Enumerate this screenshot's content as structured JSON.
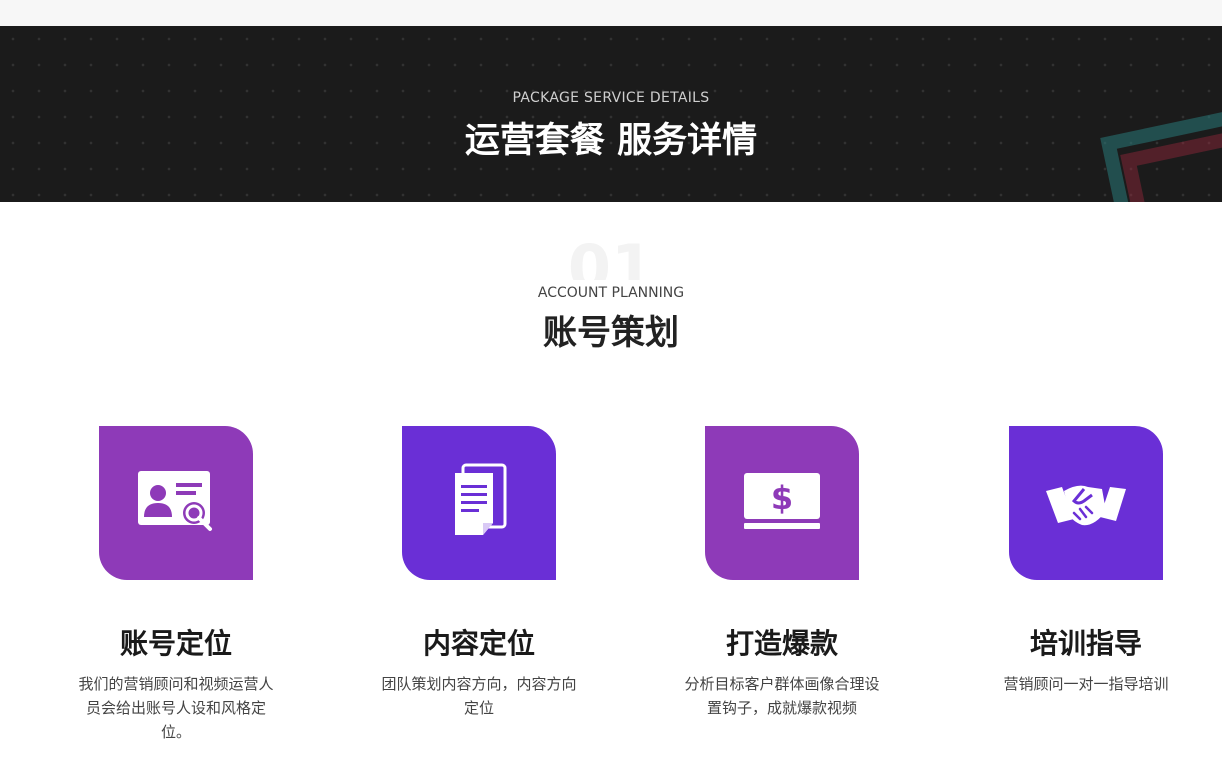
{
  "banner": {
    "subtitle": "PACKAGE SERVICE DETAILS",
    "title": "运营套餐 服务详情"
  },
  "section": {
    "number": "01",
    "subtitle": "ACCOUNT PLANNING",
    "title": "账号策划"
  },
  "colors": {
    "accent_magenta": "#8e3ab8",
    "accent_violet": "#6a2fd6"
  },
  "cards": [
    {
      "icon": "id-card-search-icon",
      "title": "账号定位",
      "description": "我们的营销顾问和视频运营人员会给出账号人设和风格定位。"
    },
    {
      "icon": "document-icon",
      "title": "内容定位",
      "description": "团队策划内容方向，内容方向定位"
    },
    {
      "icon": "laptop-dollar-icon",
      "title": "打造爆款",
      "description": "分析目标客户群体画像合理设置钩子，成就爆款视频"
    },
    {
      "icon": "handshake-icon",
      "title": "培训指导",
      "description": "营销顾问一对一指导培训"
    }
  ]
}
